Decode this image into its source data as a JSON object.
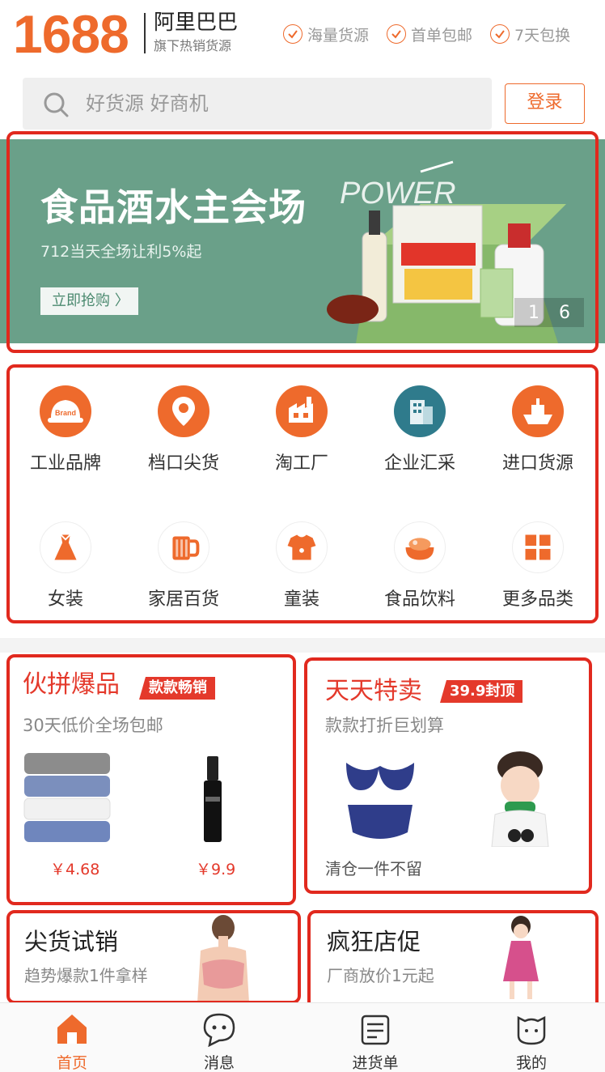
{
  "header": {
    "logo_number": "1688",
    "logo_name": "阿里巴巴",
    "logo_sub": "旗下热销货源",
    "features": [
      "海量货源",
      "首单包邮",
      "7天包换"
    ]
  },
  "search": {
    "placeholder": "好货源 好商机",
    "login": "登录"
  },
  "banner": {
    "title": "食品酒水主会场",
    "power_text": "POWER",
    "subtitle": "712当天全场让利5%起",
    "button": "立即抢购 〉",
    "page_current": "1",
    "page_total": "6"
  },
  "categories": [
    {
      "label": "工业品牌",
      "icon": "brand-helmet-icon"
    },
    {
      "label": "档口尖货",
      "icon": "location-pin-icon"
    },
    {
      "label": "淘工厂",
      "icon": "factory-icon"
    },
    {
      "label": "企业汇采",
      "icon": "building-icon"
    },
    {
      "label": "进口货源",
      "icon": "ship-icon"
    },
    {
      "label": "女装",
      "icon": "dress-icon"
    },
    {
      "label": "家居百货",
      "icon": "mug-icon"
    },
    {
      "label": "童装",
      "icon": "baby-clothes-icon"
    },
    {
      "label": "食品饮料",
      "icon": "food-bowl-icon"
    },
    {
      "label": "更多品类",
      "icon": "grid-icon"
    }
  ],
  "promos": {
    "group_buy": {
      "title": "伙拼爆品",
      "tag": "款款畅销",
      "subtitle": "30天低价全场包邮",
      "price1": "￥4.68",
      "price2": "￥9.9"
    },
    "daily_sale": {
      "title": "天天特卖",
      "tag": "39.9封顶",
      "subtitle": "款款打折巨划算",
      "caption": "清仓一件不留"
    },
    "trial": {
      "title": "尖货试销",
      "subtitle": "趋势爆款1件拿样"
    },
    "store_promo": {
      "title": "疯狂店促",
      "subtitle": "厂商放价1元起"
    }
  },
  "tabbar": [
    {
      "label": "首页",
      "icon": "home-icon",
      "active": true
    },
    {
      "label": "消息",
      "icon": "message-icon",
      "active": false
    },
    {
      "label": "进货单",
      "icon": "order-list-icon",
      "active": false
    },
    {
      "label": "我的",
      "icon": "profile-icon",
      "active": false
    }
  ],
  "colors": {
    "brand": "#ee6a2c",
    "accent_red": "#e4392b",
    "banner_green": "#6aa089"
  }
}
